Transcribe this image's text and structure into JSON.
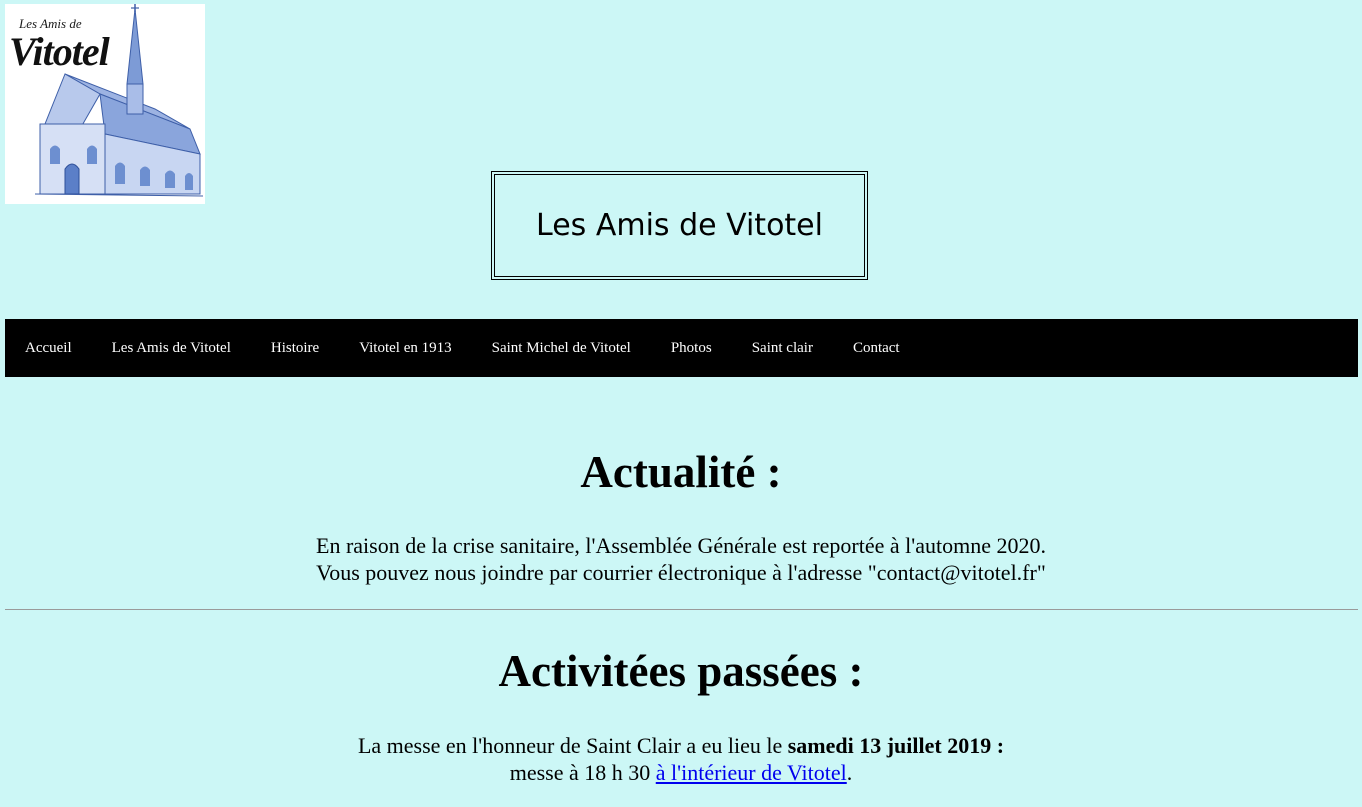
{
  "logo": {
    "small_text": "Les Amis de",
    "big_text": "Vitotel",
    "image_name": "church-drawing"
  },
  "header": {
    "title": "Les Amis de Vitotel"
  },
  "nav": {
    "items": [
      {
        "label": "Accueil"
      },
      {
        "label": "Les Amis de Vitotel"
      },
      {
        "label": "Histoire"
      },
      {
        "label": "Vitotel en 1913"
      },
      {
        "label": "Saint Michel de Vitotel"
      },
      {
        "label": "Photos"
      },
      {
        "label": "Saint clair"
      },
      {
        "label": "Contact"
      }
    ]
  },
  "news": {
    "title": "Actualité :",
    "line1": "En raison de la crise sanitaire, l'Assemblée Générale est reportée à l'automne 2020.",
    "line2": "Vous pouvez nous joindre par courrier électronique à l'adresse \"contact@vitotel.fr\""
  },
  "past": {
    "title": "Activitées passées :",
    "line1_prefix": "La messe en l'honneur de Saint Clair a eu lieu le ",
    "line1_bold": "samedi 13 juillet 2019 :",
    "line2_prefix": "messe à 18 h 30 ",
    "line2_link": "à l'intérieur de Vitotel",
    "line2_suffix": "."
  },
  "colors": {
    "background": "#ccf7f6",
    "navbar": "#000000",
    "nav_text": "#ffffff",
    "link": "#0000ee"
  }
}
